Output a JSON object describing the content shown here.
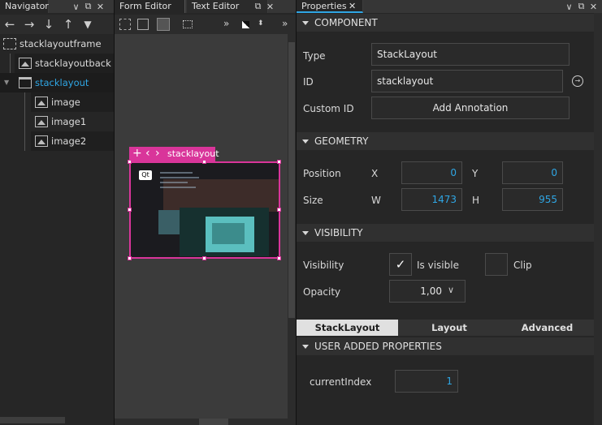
{
  "panels": {
    "navigator": {
      "title": "Navigator"
    },
    "form_editor": {
      "title": "Form Editor"
    },
    "text_editor": {
      "title": "Text Editor"
    },
    "properties": {
      "title": "Properties"
    }
  },
  "navigator": {
    "toolbar_icons": [
      "arrow-left-icon",
      "arrow-right-icon",
      "arrow-down-icon",
      "arrow-up-icon",
      "filter-icon"
    ],
    "items": [
      {
        "label": "stacklayoutframe",
        "icon": "frame-icon"
      },
      {
        "label": "stacklayoutback",
        "icon": "image-icon"
      },
      {
        "label": "stacklayout",
        "icon": "layout-icon",
        "selected": true
      },
      {
        "label": "image",
        "icon": "image-icon"
      },
      {
        "label": "image1",
        "icon": "image-icon"
      },
      {
        "label": "image2",
        "icon": "image-icon"
      }
    ]
  },
  "canvas": {
    "selection_label": "stacklayout",
    "selection_controls": [
      "+",
      "‹",
      "›"
    ],
    "preview_logo": "Qt",
    "accent_color": "#d9359a"
  },
  "properties": {
    "component": {
      "header": "COMPONENT",
      "type_label": "Type",
      "type_value": "StackLayout",
      "id_label": "ID",
      "id_value": "stacklayout",
      "custom_id_label": "Custom ID",
      "annotation_button": "Add Annotation"
    },
    "geometry": {
      "header": "GEOMETRY",
      "position_label": "Position",
      "x_label": "X",
      "x_value": "0",
      "y_label": "Y",
      "y_value": "0",
      "size_label": "Size",
      "w_label": "W",
      "w_value": "1473",
      "h_label": "H",
      "h_value": "955"
    },
    "visibility": {
      "header": "VISIBILITY",
      "visibility_label": "Visibility",
      "is_visible_label": "Is visible",
      "is_visible": true,
      "clip_label": "Clip",
      "clip": false,
      "opacity_label": "Opacity",
      "opacity_value": "1,00"
    },
    "tabs": [
      "StackLayout",
      "Layout",
      "Advanced"
    ],
    "user_props": {
      "header": "USER ADDED PROPERTIES",
      "current_index_label": "currentIndex",
      "current_index_value": "1"
    }
  }
}
